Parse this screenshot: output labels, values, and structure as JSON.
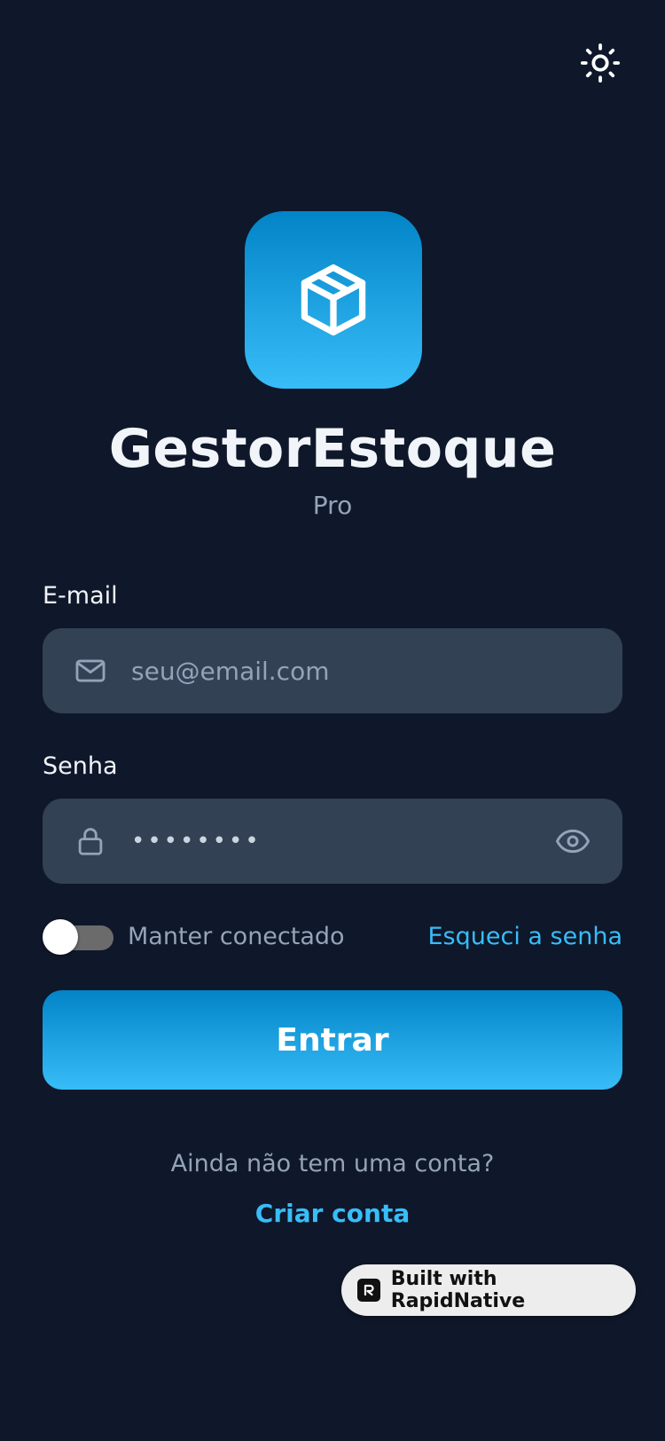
{
  "app": {
    "title": "GestorEstoque",
    "subtitle": "Pro"
  },
  "icons": {
    "theme": "sun-icon",
    "logo": "package-box-icon",
    "email": "mail-icon",
    "password": "lock-icon",
    "show_password": "eye-icon"
  },
  "form": {
    "email_label": "E-mail",
    "email_placeholder": "seu@email.com",
    "email_value": "",
    "password_label": "Senha",
    "password_value": "••••••••",
    "keep_connected_label": "Manter conectado",
    "keep_connected": false,
    "forgot_link": "Esqueci a senha",
    "submit_label": "Entrar"
  },
  "signup": {
    "prompt": "Ainda não tem uma conta?",
    "link": "Criar conta"
  },
  "badge": {
    "label": "Built with RapidNative"
  },
  "colors": {
    "background": "#0f172a",
    "field": "#334155",
    "accent": "#38bdf8",
    "accent_dark": "#0284c7",
    "muted_text": "#94a3b8",
    "primary_text": "#f1f5f9"
  }
}
